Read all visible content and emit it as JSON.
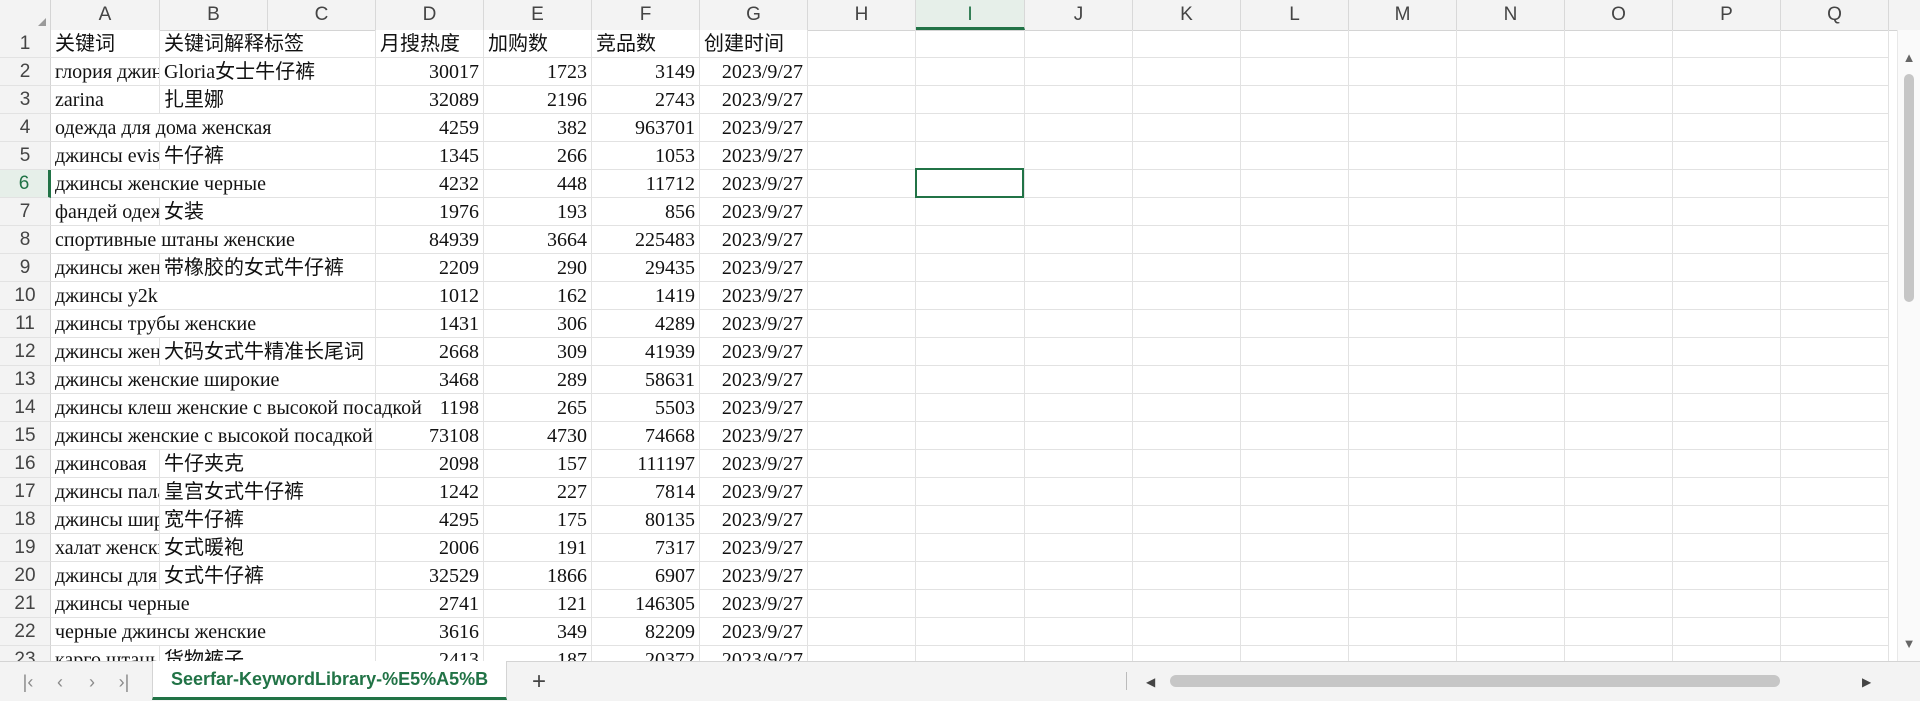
{
  "columns": [
    "A",
    "B",
    "C",
    "D",
    "E",
    "F",
    "G",
    "H",
    "I",
    "J",
    "K",
    "L",
    "M",
    "N",
    "O",
    "P",
    "Q"
  ],
  "active_column": "I",
  "active_row": "6",
  "row_numbers": [
    "1",
    "2",
    "3",
    "4",
    "5",
    "6",
    "7",
    "8",
    "9",
    "10",
    "11",
    "12",
    "13",
    "14",
    "15",
    "16",
    "17",
    "18",
    "19",
    "20",
    "21",
    "22",
    "23"
  ],
  "rows": [
    {
      "a": "关键词",
      "b": "关键词解释标签",
      "d": "月搜热度",
      "e": "加购数",
      "f": "竞品数",
      "g": "创建时间"
    },
    {
      "a": "глория джинс",
      "b": "Gloria女士牛仔裤",
      "d": "30017",
      "e": "1723",
      "f": "3149",
      "g": "2023/9/27"
    },
    {
      "a": "zarina",
      "b": "扎里娜",
      "d": "32089",
      "e": "2196",
      "f": "2743",
      "g": "2023/9/27"
    },
    {
      "a": "одежда для дома женская",
      "b": "",
      "d": "4259",
      "e": "382",
      "f": "963701",
      "g": "2023/9/27"
    },
    {
      "a": "джинсы evis",
      "b": "牛仔裤",
      "d": "1345",
      "e": "266",
      "f": "1053",
      "g": "2023/9/27"
    },
    {
      "a": "джинсы женские черные",
      "b": "",
      "d": "4232",
      "e": "448",
      "f": "11712",
      "g": "2023/9/27"
    },
    {
      "a": "фандей одежда",
      "b": "女装",
      "d": "1976",
      "e": "193",
      "f": "856",
      "g": "2023/9/27"
    },
    {
      "a": "спортивные штаны женские",
      "b": "",
      "d": "84939",
      "e": "3664",
      "f": "225483",
      "g": "2023/9/27"
    },
    {
      "a": "джинсы женские",
      "b": "带橡胶的女式牛仔裤",
      "d": "2209",
      "e": "290",
      "f": "29435",
      "g": "2023/9/27"
    },
    {
      "a": "джинсы y2k",
      "b": "",
      "d": "1012",
      "e": "162",
      "f": "1419",
      "g": "2023/9/27"
    },
    {
      "a": "джинсы трубы женские",
      "b": "",
      "d": "1431",
      "e": "306",
      "f": "4289",
      "g": "2023/9/27"
    },
    {
      "a": "джинсы женские",
      "b": "大码女式牛精准长尾词",
      "d": "2668",
      "e": "309",
      "f": "41939",
      "g": "2023/9/27"
    },
    {
      "a": "джинсы женские широкие",
      "b": "",
      "d": "3468",
      "e": "289",
      "f": "58631",
      "g": "2023/9/27"
    },
    {
      "a": "джинсы клеш женские с высокой посадкой",
      "b": "",
      "d": "1198",
      "e": "265",
      "f": "5503",
      "g": "2023/9/27"
    },
    {
      "a": "джинсы женские с высокой посадкой",
      "b": "",
      "d": "73108",
      "e": "4730",
      "f": "74668",
      "g": "2023/9/27"
    },
    {
      "a": "джинсовая",
      "b": "牛仔夹克",
      "d": "2098",
      "e": "157",
      "f": "111197",
      "g": "2023/9/27"
    },
    {
      "a": "джинсы палаццо",
      "b": "皇宫女式牛仔裤",
      "d": "1242",
      "e": "227",
      "f": "7814",
      "g": "2023/9/27"
    },
    {
      "a": "джинсы широкие",
      "b": "宽牛仔裤",
      "d": "4295",
      "e": "175",
      "f": "80135",
      "g": "2023/9/27"
    },
    {
      "a": "халат женский",
      "b": "女式暖袍",
      "d": "2006",
      "e": "191",
      "f": "7317",
      "g": "2023/9/27"
    },
    {
      "a": "джинсы для женщин",
      "b": "女式牛仔裤",
      "d": "32529",
      "e": "1866",
      "f": "6907",
      "g": "2023/9/27"
    },
    {
      "a": "джинсы черные",
      "b": "",
      "d": "2741",
      "e": "121",
      "f": "146305",
      "g": "2023/9/27"
    },
    {
      "a": "черные джинсы женские",
      "b": "",
      "d": "3616",
      "e": "349",
      "f": "82209",
      "g": "2023/9/27"
    },
    {
      "a": "карго штаны",
      "b": "货物裤子",
      "d": "2413",
      "e": "187",
      "f": "20372",
      "g": "2023/9/27"
    }
  ],
  "sheet_tab": "Seerfar-KeywordLibrary-%E5%A5%B",
  "icons": {
    "first": "first-sheet-icon",
    "prev": "prev-sheet-icon",
    "next": "next-sheet-icon",
    "last": "last-sheet-icon",
    "add": "add-sheet-icon",
    "scroll_up": "scroll-up-icon",
    "scroll_down": "scroll-down-icon",
    "scroll_left": "scroll-left-icon",
    "scroll_right": "scroll-right-icon"
  },
  "colors": {
    "accent": "#217346",
    "header_bg": "#f3f3f3",
    "grid": "#e2e2e2"
  }
}
